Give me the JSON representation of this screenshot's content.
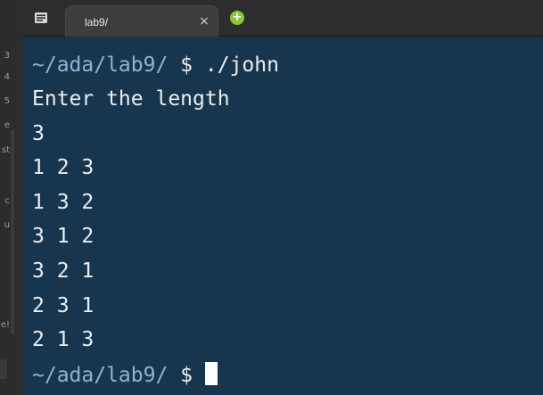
{
  "left_strip": {
    "fragments": [
      "3",
      "4",
      "5",
      "e",
      "st",
      "c",
      "u",
      "e!"
    ]
  },
  "tab": {
    "title": "lab9/",
    "close_glyph": "×",
    "new_tab_glyph": "+",
    "menu_icon": "tab-menu-icon"
  },
  "terminal": {
    "prompt1_path": "~/ada/lab9/",
    "prompt1_rest": " $ ./john",
    "output": [
      "Enter the length",
      "3",
      "1 2 3",
      "1 3 2",
      "3 1 2",
      "3 2 1",
      "2 3 1",
      "2 1 3"
    ],
    "prompt2_path": "~/ada/lab9/",
    "prompt2_rest": " $ "
  },
  "colors": {
    "terminal_bg": "#17364d",
    "prompt_path": "#8fb2d4",
    "text": "#e9eef2",
    "new_tab": "#8cc63f"
  }
}
